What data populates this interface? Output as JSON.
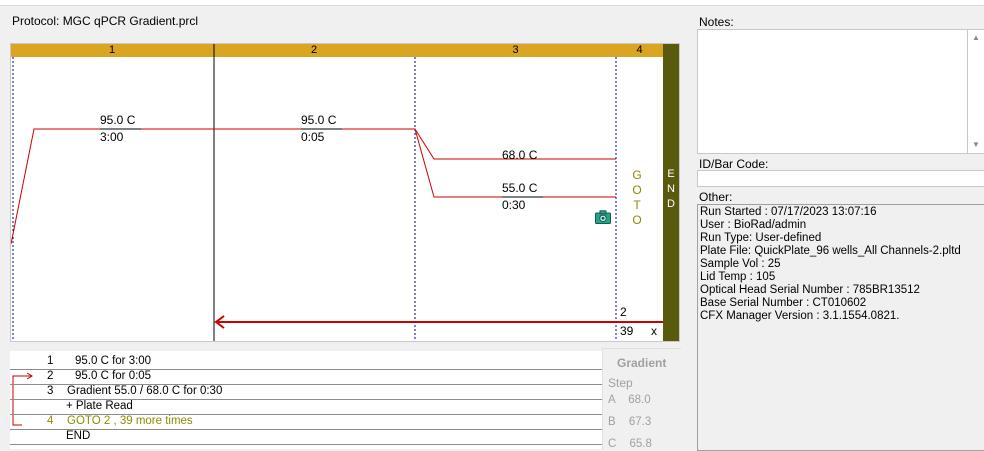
{
  "protocol": {
    "title": "Protocol: MGC qPCR Gradient.prcl"
  },
  "graph": {
    "steps": [
      "1",
      "2",
      "3",
      "4"
    ],
    "end_letters": [
      "E",
      "N",
      "D"
    ],
    "goto_letters": [
      "G",
      "O",
      "T",
      "O"
    ],
    "step1": {
      "temp": "95.0   C",
      "time": "3:00"
    },
    "step2": {
      "temp": "95.0   C",
      "time": "0:05"
    },
    "step3_high": {
      "temp": "68.0   C"
    },
    "step3_low": {
      "temp": "55.0   C",
      "time": "0:30"
    },
    "goto_target": "2",
    "goto_count": "39",
    "goto_x": "x",
    "camera_icon": "camera-icon",
    "colors": {
      "step_bar": "#daa520",
      "end_bar": "#5a5a0e",
      "temp_line": "#cc0000",
      "goto_text": "#8c8c00"
    }
  },
  "list": {
    "rows": [
      {
        "num": "1",
        "text": "95.0  C  for  3:00"
      },
      {
        "num": "2",
        "text": "95.0  C  for  0:05"
      },
      {
        "num": "3",
        "text": "Gradient     55.0   /     68.0  C  for  0:30"
      },
      {
        "num": "",
        "text": "+ Plate Read"
      },
      {
        "num": "4",
        "text": "GOTO     2   ,      39   more times"
      },
      {
        "num": "",
        "text": "END"
      }
    ]
  },
  "gradient": {
    "title": "Gradient",
    "step_label": "Step",
    "rows": [
      {
        "letter": "A",
        "value": "68.0"
      },
      {
        "letter": "B",
        "value": "67.3"
      },
      {
        "letter": "C",
        "value": "65.8"
      }
    ]
  },
  "notes": {
    "label": "Notes:"
  },
  "idbar": {
    "label": "ID/Bar Code:"
  },
  "other": {
    "label": "Other:",
    "lines": [
      "Run Started : 07/17/2023 13:07:16",
      "User : BioRad/admin",
      "Run Type: User-defined",
      "Plate File: QuickPlate_96 wells_All Channels-2.pltd",
      "Sample Vol : 25",
      "Lid Temp : 105",
      "Optical Head Serial Number : 785BR13512",
      "Base Serial Number : CT010602",
      "CFX Manager Version : 3.1.1554.0821."
    ]
  }
}
